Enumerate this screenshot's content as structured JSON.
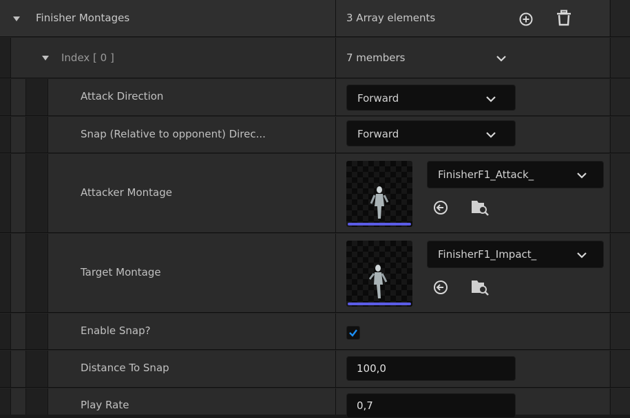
{
  "header": {
    "title": "Finisher Montages",
    "count": "3 Array elements",
    "add_icon": "add-circle-icon",
    "delete_icon": "trash-icon"
  },
  "index_row": {
    "label": "Index [ 0 ]",
    "members": "7 members"
  },
  "properties": {
    "attack_direction": {
      "label": "Attack Direction",
      "value": "Forward"
    },
    "snap_direction": {
      "label": "Snap (Relative to opponent) Direc...",
      "value": "Forward"
    },
    "attacker_montage": {
      "label": "Attacker Montage",
      "asset": "FinisherF1_Attack_"
    },
    "target_montage": {
      "label": "Target Montage",
      "asset": "FinisherF1_Impact_"
    },
    "enable_snap": {
      "label": "Enable Snap?",
      "checked": true
    },
    "distance_to_snap": {
      "label": "Distance To Snap",
      "value": "100,0"
    },
    "play_rate": {
      "label": "Play Rate",
      "value": "0,7"
    }
  },
  "colors": {
    "accent_check": "#1c8ff5",
    "thumb_bar": "#5b5ce6"
  }
}
